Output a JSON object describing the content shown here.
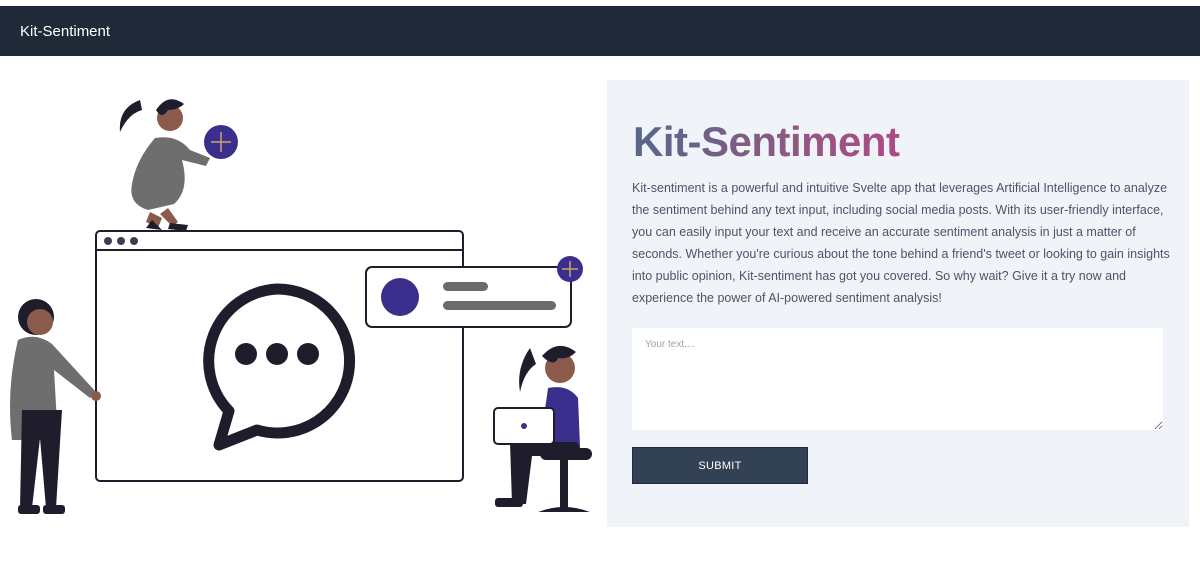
{
  "navbar": {
    "brand": "Kit-Sentiment"
  },
  "hero": {
    "title": "Kit-Sentiment",
    "description": "Kit-sentiment is a powerful and intuitive Svelte app that leverages Artificial Intelligence to analyze the sentiment behind any text input, including social media posts. With its user-friendly interface, you can easily input your text and receive an accurate sentiment analysis in just a matter of seconds. Whether you're curious about the tone behind a friend's tweet or looking to gain insights into public opinion, Kit-sentiment has got you covered. So why wait? Give it a try now and experience the power of AI-powered sentiment analysis!",
    "input_placeholder": "Your text....",
    "input_value": "",
    "submit_label": "SUBMIT"
  },
  "colors": {
    "navbar_bg": "#1f2937",
    "panel_bg": "#f0f3f8",
    "button_bg": "#334155",
    "accent_purple": "#3a2f8c",
    "title_gradient_start": "#56668a",
    "title_gradient_end": "#b04a86"
  },
  "icons": [
    "chat-bubble-icon",
    "plus-icon",
    "avatar-circle-icon",
    "window-dots-icon"
  ]
}
